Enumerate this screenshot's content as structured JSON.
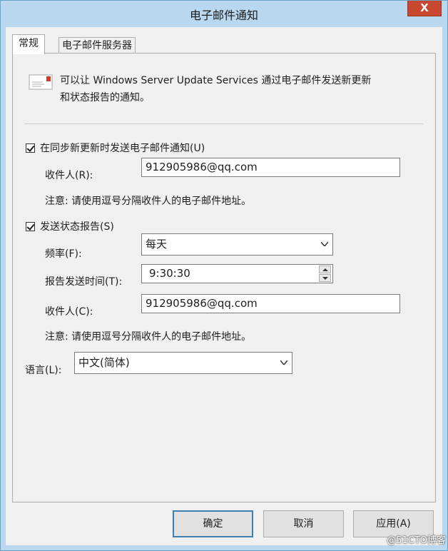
{
  "window": {
    "title": "电子邮件通知",
    "close_glyph": "X"
  },
  "tabs": [
    {
      "label": "常规",
      "active": true
    },
    {
      "label": "电子邮件服务器",
      "active": false
    }
  ],
  "intro": {
    "icon": "mail-envelope-icon",
    "text_line1": "可以让 Windows Server Update Services 通过电子邮件发送新更新",
    "text_line2": "和状态报告的通知。"
  },
  "sync_notify": {
    "checkbox_label": "在同步新更新时发送电子邮件通知(U)",
    "checked": true,
    "recipients_label": "收件人(R):",
    "recipients_value": "912905986@qq.com",
    "note": "注意: 请使用逗号分隔收件人的电子邮件地址。"
  },
  "status_report": {
    "checkbox_label": "发送状态报告(S)",
    "checked": true,
    "frequency_label": "频率(F):",
    "frequency_value": "每天",
    "send_time_label": "报告发送时间(T):",
    "send_time_value": "9:30:30",
    "recipients_label": "收件人(C):",
    "recipients_value": "912905986@qq.com",
    "note": "注意: 请使用逗号分隔收件人的电子邮件地址。"
  },
  "language": {
    "label": "语言(L):",
    "value": "中文(简体)"
  },
  "buttons": {
    "ok": "确定",
    "cancel": "取消",
    "apply": "应用(A)"
  },
  "watermark": "@51CTO博客"
}
